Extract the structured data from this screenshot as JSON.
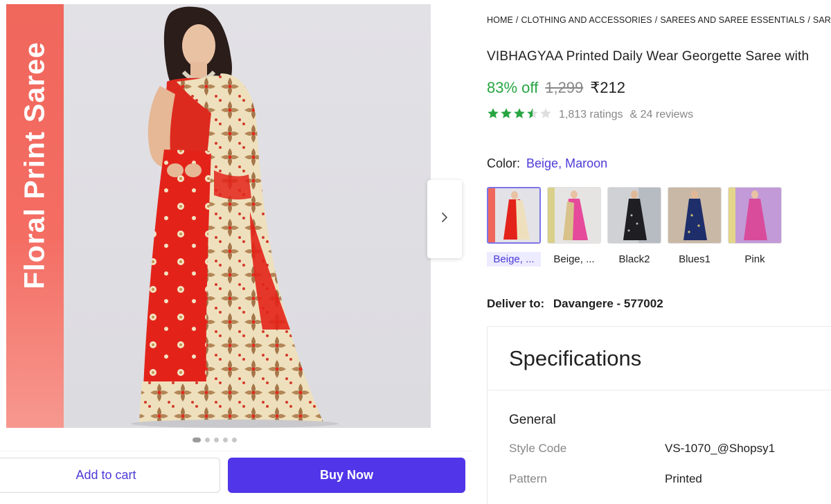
{
  "gallery": {
    "promo_text": "Floral Print Saree",
    "dots_count": 5,
    "active_dot": 0
  },
  "actions": {
    "add_to_cart": "Add to cart",
    "buy_now": "Buy Now"
  },
  "breadcrumb": [
    "HOME",
    "CLOTHING AND ACCESSORIES",
    "SAREES AND SAREE ESSENTIALS",
    "SAREE"
  ],
  "product": {
    "title": "VIBHAGYAA Printed Daily Wear Georgette Saree with",
    "discount": "83% off",
    "mrp": "1,299",
    "price": "₹212",
    "rating": 3.5,
    "ratings_text": "1,813 ratings",
    "reviews_text": "& 24 reviews"
  },
  "color": {
    "label": "Color:",
    "value": "Beige, Maroon",
    "swatches": [
      {
        "label": "Beige, ...",
        "selected": true
      },
      {
        "label": "Beige, ...",
        "selected": false
      },
      {
        "label": "Black2",
        "selected": false
      },
      {
        "label": "Blues1",
        "selected": false
      },
      {
        "label": "Pink",
        "selected": false
      }
    ]
  },
  "delivery": {
    "label": "Deliver to:",
    "location": "Davangere - 577002"
  },
  "specifications": {
    "title": "Specifications",
    "section": "General",
    "rows": [
      {
        "key": "Style Code",
        "value": "VS-1070_@Shopsy1"
      },
      {
        "key": "Pattern",
        "value": "Printed"
      }
    ]
  },
  "colors": {
    "accent": "#5036e8",
    "link": "#4b3bd8",
    "discount_green": "#26a541",
    "promo_band": "#f0675c",
    "saree_red": "#e5281e",
    "saree_beige": "#eedcb6"
  }
}
